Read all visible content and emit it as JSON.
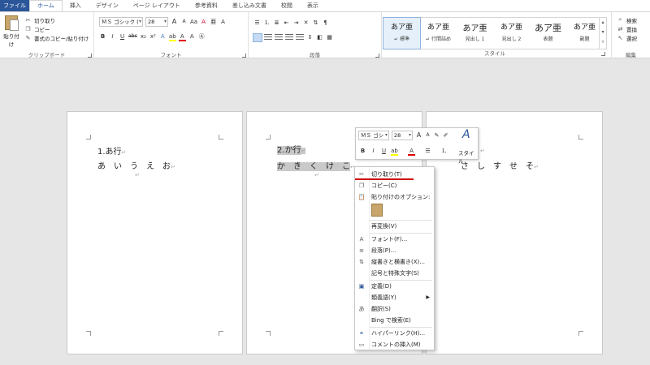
{
  "tabs": [
    "ファイル",
    "ホーム",
    "挿入",
    "デザイン",
    "ページ レイアウト",
    "参考資料",
    "差し込み文書",
    "校閲",
    "表示"
  ],
  "clipboard": {
    "paste": "貼り付け",
    "cut": "切り取り",
    "copy": "コピー",
    "format_painter": "書式のコピー/貼り付け",
    "label": "クリップボード"
  },
  "font": {
    "name": "ＭＳ ゴシック (",
    "size": "28",
    "grow": "A",
    "shrink": "A",
    "case": "Aa",
    "clear": "A",
    "bold": "B",
    "italic": "I",
    "underline": "U",
    "strike": "abc",
    "sub": "x₂",
    "sup": "x²",
    "effects": "A",
    "highlight": "ab",
    "color": "A",
    "label": "フォント"
  },
  "paragraph": {
    "label": "段落"
  },
  "styles": {
    "items": [
      {
        "preview": "あア亜",
        "name": "↵ 標準"
      },
      {
        "preview": "あア亜",
        "name": "↵ 行間詰め"
      },
      {
        "preview": "あア亜",
        "name": "見出し 1"
      },
      {
        "preview": "あア亜",
        "name": "見出し 2"
      },
      {
        "preview": "あア亜",
        "name": "表題"
      },
      {
        "preview": "あア亜",
        "name": "副題"
      }
    ],
    "label": "スタイル"
  },
  "editing": {
    "find": "検索",
    "replace": "置換",
    "select": "選択",
    "label": "編集"
  },
  "document": {
    "page1": {
      "heading": "1.あ行",
      "body": "あ　い　う　え　お"
    },
    "page2": {
      "heading": "2.か行",
      "body": "か　き　く　け　こ"
    },
    "page3": {
      "body": "さ　し　す　せ　そ"
    }
  },
  "mini_toolbar": {
    "font": "ＭＳ ゴシ",
    "size": "28",
    "bold": "B",
    "italic": "I",
    "underline": "U",
    "styles": "スタイル"
  },
  "context_menu": {
    "cut": "切り取り(T)",
    "copy": "コピー(C)",
    "paste_options": "貼り付けのオプション:",
    "reconvert": "再変換(V)",
    "font": "フォント(F)...",
    "paragraph": "段落(P)...",
    "vertical": "縦書きと横書き(X)...",
    "symbols": "記号と特殊文字(S)",
    "define": "定義(D)",
    "synonyms": "類義語(Y)",
    "translate": "翻訳(S)",
    "bing": "Bing で検索(E)",
    "hyperlink": "ハイパーリンク(H)...",
    "comment": "コメントの挿入(M)"
  },
  "colors": {
    "file_tab": "#2b579a",
    "cut_underline": "#d00000",
    "highlight_yellow": "#ffff00",
    "font_red": "#e00000"
  }
}
